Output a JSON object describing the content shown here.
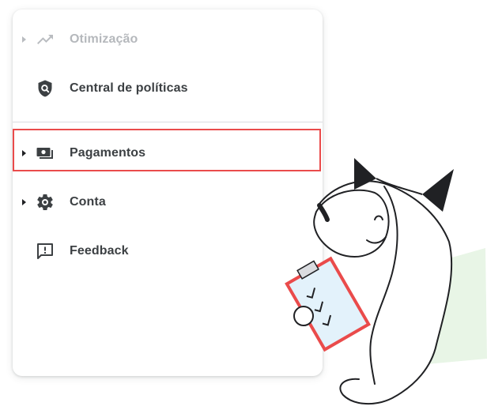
{
  "nav": {
    "items": [
      {
        "label": "Otimização",
        "icon": "trending-up-icon",
        "has_caret": true,
        "dimmed": true
      },
      {
        "label": "Central de políticas",
        "icon": "policy-shield-icon",
        "has_caret": false,
        "dimmed": false
      },
      {
        "label": "Pagamentos",
        "icon": "payments-icon",
        "has_caret": true,
        "dimmed": false,
        "highlighted": true
      },
      {
        "label": "Conta",
        "icon": "gear-icon",
        "has_caret": true,
        "dimmed": false
      },
      {
        "label": "Feedback",
        "icon": "feedback-icon",
        "has_caret": false,
        "dimmed": false
      }
    ]
  },
  "colors": {
    "highlight_border": "#ea4b4b",
    "text": "#3c4043",
    "text_dimmed": "#b5b8bc",
    "mascot_accent": "#e8f5e6",
    "clipboard_fill": "#e3f2fb"
  }
}
